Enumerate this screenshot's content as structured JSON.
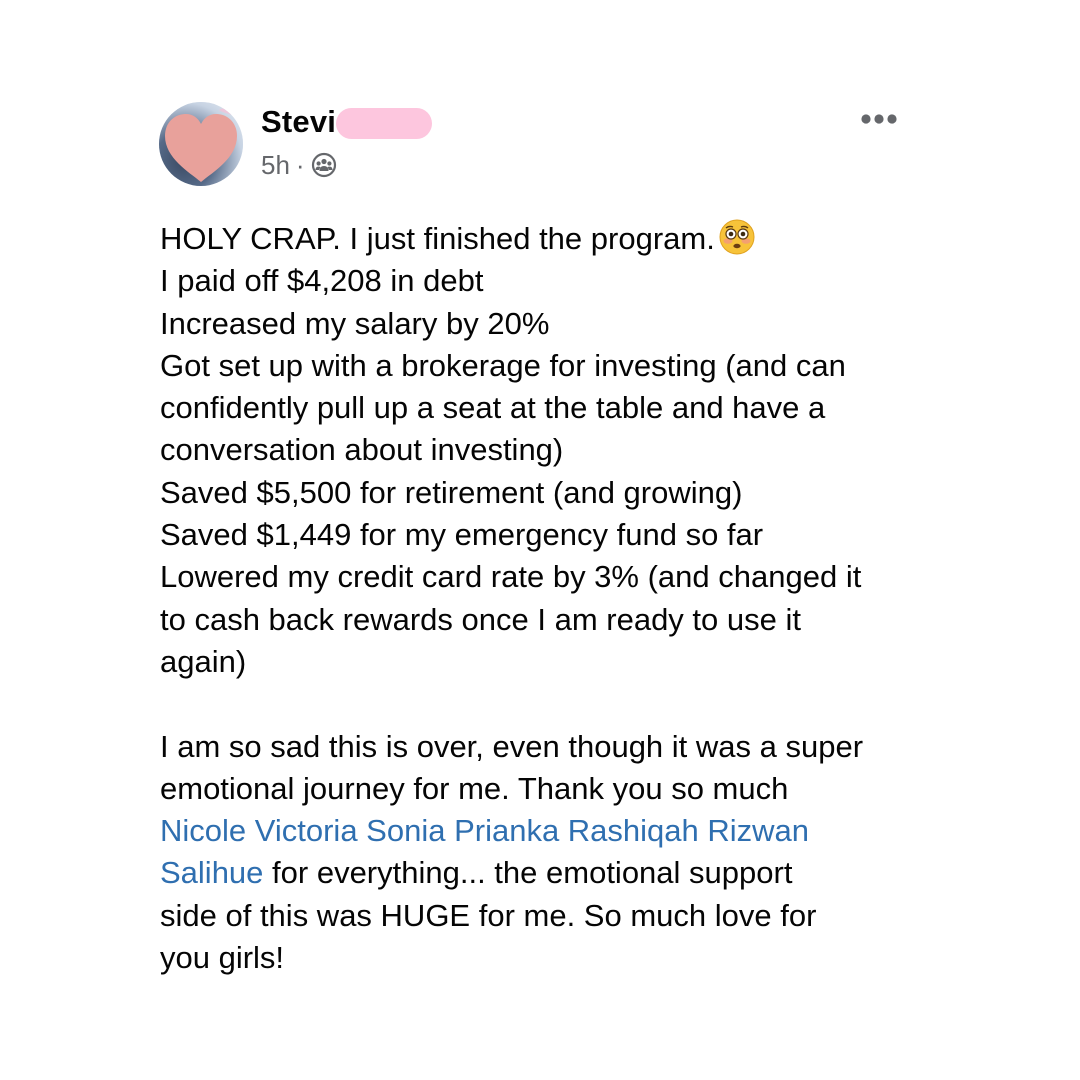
{
  "post": {
    "author": {
      "name": "Stevi",
      "avatar": "avatar-heart-obscured"
    },
    "meta": {
      "time": "5h",
      "separator": "·",
      "audience_icon": "group-audience-icon"
    },
    "more_icon": "more-options-icon",
    "lines": [
      "HOLY CRAP. I just finished the program.",
      "I paid off $4,208 in debt",
      "Increased my salary by 20%",
      "Got set up with a brokerage for investing (and can",
      "confidently pull up a seat at the table and have a",
      "conversation about investing)",
      "Saved $5,500 for retirement (and growing)",
      "Saved $1,449 for my emergency fund so far",
      "Lowered my credit card rate by 3% (and changed it",
      "to cash back rewards once I am ready to use it",
      "again)",
      "I am so sad this is over, even though it was a super",
      "emotional journey for me. Thank you so much"
    ],
    "emoji_name": "flushed-face-emoji",
    "mention_line": "Nicole Victoria Sonia Prianka Rashiqah Rizwan",
    "mention_cont": "Salihue",
    "after_mention": " for everything... the emotional support",
    "closing_lines": [
      "side of this was HUGE for me. So much love for",
      "you girls!"
    ],
    "colors": {
      "text": "#050505",
      "secondary": "#65676b",
      "mention": "#2f6fb0",
      "redaction": "#fdc6de",
      "avatar_heart": "#e8a19b"
    }
  }
}
